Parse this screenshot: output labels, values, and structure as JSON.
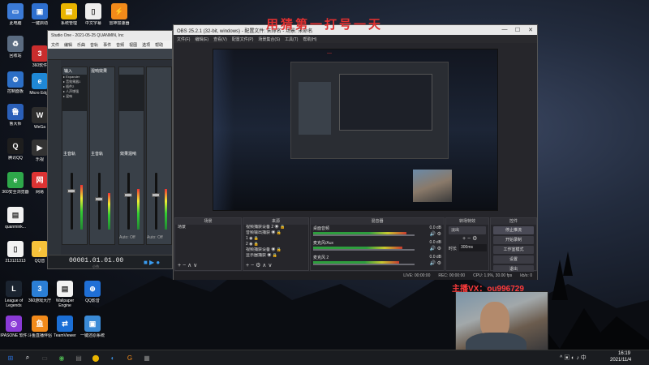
{
  "overlay": {
    "top_text": "用猜第一打号一天",
    "wechat_label": "主播VX：ou996729"
  },
  "desktop": {
    "icons": [
      {
        "label": "此电脑",
        "color": "#3b7ad6",
        "glyph": "▭"
      },
      {
        "label": "回收站",
        "color": "#5a6b80",
        "glyph": "♻"
      },
      {
        "label": "控制面板",
        "color": "#2c6fc7",
        "glyph": "⚙"
      },
      {
        "label": "鲁大师",
        "color": "#2a5fb8",
        "glyph": "鲁"
      },
      {
        "label": "腾讯QQ",
        "color": "#1e1e1e",
        "glyph": "Q"
      },
      {
        "label": "360安全浏览器",
        "color": "#2ea84a",
        "glyph": "e"
      },
      {
        "label": "quanmink...",
        "color": "#f2f2f2",
        "glyph": "▤"
      },
      {
        "label": "213121313",
        "color": "#f2f2f2",
        "glyph": "▯"
      },
      {
        "label": "一键启动",
        "color": "#2e6fcf",
        "glyph": "▣"
      },
      {
        "label": "360软件",
        "color": "#c92d2d",
        "glyph": "3"
      },
      {
        "label": "Micro Edge",
        "color": "#1f88d6",
        "glyph": "e"
      },
      {
        "label": "WeGa",
        "color": "#2d2d2d",
        "glyph": "W"
      },
      {
        "label": "乐视",
        "color": "#333",
        "glyph": "▶"
      },
      {
        "label": "网易",
        "color": "#d33",
        "glyph": "网"
      },
      {
        "label": "QQ音",
        "color": "#f7c23a",
        "glyph": "♪"
      },
      {
        "label": "系统管理",
        "color": "#e9b400",
        "glyph": "▤"
      },
      {
        "label": "中文字幕",
        "color": "#eee",
        "glyph": "▯"
      },
      {
        "label": "雷神加速器",
        "color": "#f28a1a",
        "glyph": "⚡"
      }
    ],
    "bottom_icons": [
      {
        "label": "League of Legends",
        "color": "#1b2430",
        "glyph": "L"
      },
      {
        "label": "360游戏大厅",
        "color": "#2b7fd6",
        "glyph": "3"
      },
      {
        "label": "Wallpaper Engine",
        "color": "#f2f2f2",
        "glyph": "▤"
      },
      {
        "label": "QQ影音",
        "color": "#1f6fd6",
        "glyph": "⊕"
      },
      {
        "label": "IPASONE 软件",
        "color": "#8a3ad6",
        "glyph": "◎"
      },
      {
        "label": "斗鱼直播伴侣",
        "color": "#f28a1a",
        "glyph": "鱼"
      },
      {
        "label": "TeamViewer",
        "color": "#1b6fd6",
        "glyph": "⇄"
      },
      {
        "label": "一键还原系统",
        "color": "#3a8ad6",
        "glyph": "▣"
      }
    ]
  },
  "studio_one": {
    "title": "Studio One - 2021-05-25 QUANMIN, Inc",
    "menu": [
      "文件",
      "编辑",
      "乐曲",
      "音轨",
      "事件",
      "音频",
      "视图",
      "选项",
      "帮助"
    ],
    "time_display": "00001.01.01.00",
    "bar_label": "小节",
    "channels": [
      "输入",
      "混响效果",
      "Auto: Off",
      "Auto: Off"
    ],
    "insert_items": [
      "Expander",
      "音效果器1",
      "插件2",
      "人声增强",
      "混响"
    ],
    "channel_names": [
      "主音轨",
      "主音轨",
      "效果混响"
    ]
  },
  "obs": {
    "title": "OBS 25.2.1 (32-bit, windows) - 配置文件: 未命名 - 场景: 未命名",
    "menu": [
      "文件(F)",
      "编辑(E)",
      "查看(V)",
      "配置文件(P)",
      "场景集合(S)",
      "工具(T)",
      "帮助(H)"
    ],
    "docks": {
      "scenes": {
        "header": "场景",
        "items": [
          "场景"
        ]
      },
      "sources": {
        "header": "来源",
        "items": [
          "视频捕获设备 2",
          "音频输出捕获",
          "1",
          "2",
          "视频捕获设备",
          "显示器捕获"
        ]
      },
      "mixer": {
        "header": "混音器",
        "channels": [
          {
            "name": "桌面音频",
            "db": "0.0 dB",
            "level": 0.92
          },
          {
            "name": "麦克风/Aux",
            "db": "0.0 dB",
            "level": 0.88
          },
          {
            "name": "麦克风 2",
            "db": "0.0 dB",
            "level": 0.85
          }
        ]
      },
      "transitions": {
        "header": "转场特效",
        "type": "淡出",
        "duration_label": "时长",
        "duration": "300ms"
      },
      "controls": {
        "header": "控件",
        "buttons": [
          "停止推流",
          "开始录制",
          "工作室模式",
          "设置",
          "退出"
        ]
      }
    },
    "status": {
      "live": "LIVE: 00:00:00",
      "rec": "REC: 00:00:00",
      "cpu": "CPU: 1.9%, 30.00 fps",
      "bitrate": "kb/s: 0"
    }
  },
  "taskbar": {
    "items": [
      "⊞",
      "⌕",
      "▭",
      "◉",
      "▤",
      "⬤",
      "◐",
      "G",
      "▦"
    ],
    "time": "16:19",
    "date": "2021/11/4",
    "tray": "^ ▣ ◐ ♪ 中"
  },
  "colors": {
    "accent": "#e03030",
    "obs_bg": "#26262b",
    "obs_title": "#e9e9e9"
  }
}
